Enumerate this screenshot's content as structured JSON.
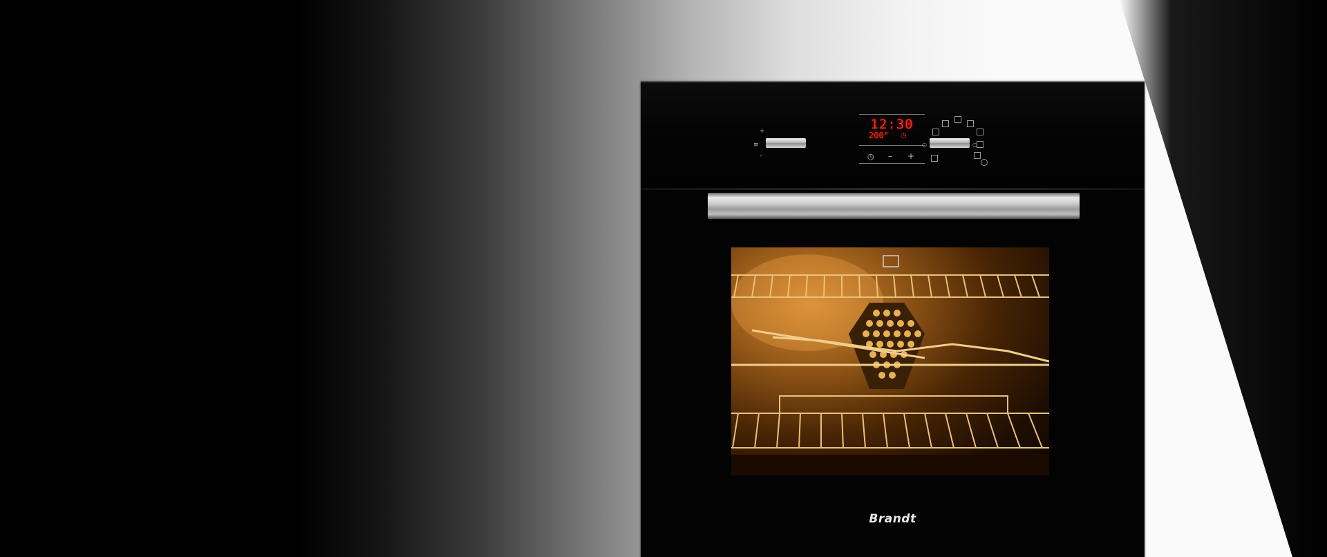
{
  "scene": {
    "subject": "built-in-oven"
  },
  "display": {
    "time": "12:30",
    "temperature": "200°"
  },
  "controls": {
    "left_knob_icon": "thermometer-icon",
    "timer_icons": [
      "clock-icon",
      "minus-icon",
      "plus-icon"
    ],
    "mode_icons": [
      "grill-icon",
      "fan-icon",
      "light-icon",
      "bottom-heat-icon",
      "top-heat-icon",
      "defrost-icon",
      "pyrolysis-icon",
      "rotisserie-icon"
    ]
  },
  "brand": {
    "logo_text": "Brandt"
  },
  "colors": {
    "display_red": "#ff2a1a",
    "oven_glow": "#d48a32",
    "oven_body": "#030303"
  }
}
